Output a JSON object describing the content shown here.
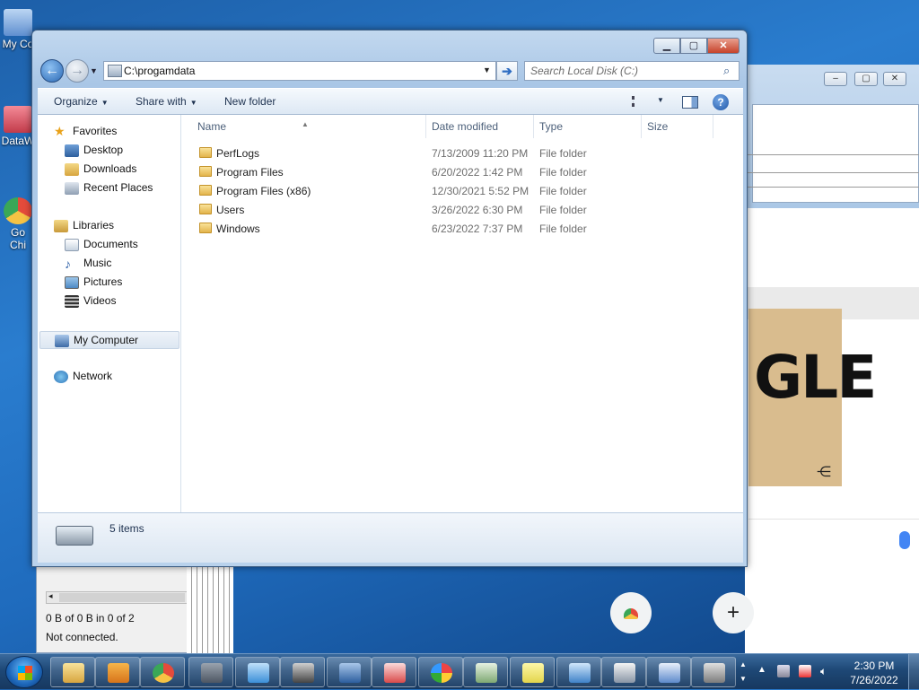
{
  "desktop": {
    "icons": [
      {
        "label": "My Co",
        "color": "#5f8fd0"
      },
      {
        "label": "DataW",
        "color": "#c23b4a"
      },
      {
        "label": "Go",
        "label2": "Chi",
        "color": "#e44b3b"
      }
    ]
  },
  "background_left": {
    "status1": "0 B of 0 B in 0 of 2",
    "status2": "Not connected."
  },
  "background_right": {
    "doodle_text": "GLE",
    "add_icon": "+"
  },
  "explorer": {
    "address": {
      "value": "C:\\progamdata"
    },
    "search": {
      "placeholder": "Search Local Disk (C:)"
    },
    "toolbar": {
      "organize": "Organize",
      "share_with": "Share with",
      "new_folder": "New folder"
    },
    "nav": {
      "favorites": "Favorites",
      "desktop": "Desktop",
      "downloads": "Downloads",
      "recent_places": "Recent Places",
      "libraries": "Libraries",
      "documents": "Documents",
      "music": "Music",
      "pictures": "Pictures",
      "videos": "Videos",
      "my_computer": "My Computer",
      "network": "Network"
    },
    "columns": {
      "name": "Name",
      "date": "Date modified",
      "type": "Type",
      "size": "Size"
    },
    "files": [
      {
        "name": "PerfLogs",
        "date": "7/13/2009 11:20 PM",
        "type": "File folder"
      },
      {
        "name": "Program Files",
        "date": "6/20/2022 1:42 PM",
        "type": "File folder"
      },
      {
        "name": "Program Files (x86)",
        "date": "12/30/2021 5:52 PM",
        "type": "File folder"
      },
      {
        "name": "Users",
        "date": "3/26/2022 6:30 PM",
        "type": "File folder"
      },
      {
        "name": "Windows",
        "date": "6/23/2022 7:37 PM",
        "type": "File folder"
      }
    ],
    "status": {
      "items": "5 items"
    }
  },
  "taskbar": {
    "time": "2:30 PM",
    "date": "7/26/2022",
    "apps": [
      "explorer",
      "media-player",
      "chrome",
      "vpn",
      "paper-plane",
      "microphone",
      "remote-desktop",
      "snipping",
      "paint",
      "document",
      "sticky-notes",
      "control-panel",
      "task-manager",
      "wordpad",
      "archive"
    ]
  }
}
